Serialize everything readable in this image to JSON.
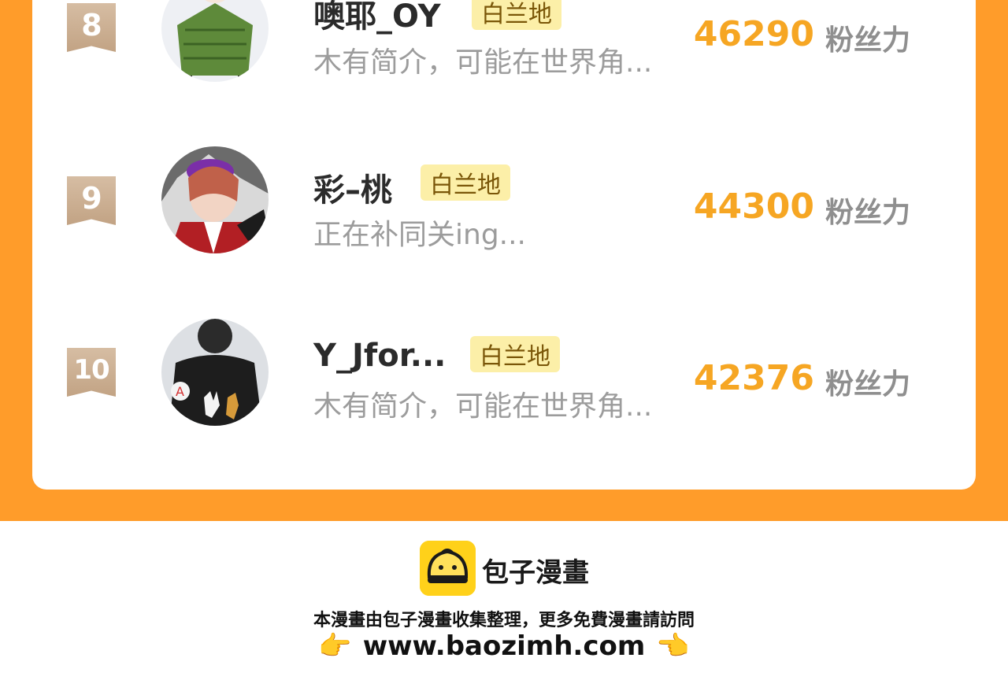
{
  "rows": [
    {
      "rank": "8",
      "name": "噢耶_OY",
      "tag": "白兰地",
      "bio": "木有简介，可能在世界角...",
      "fans": "46290",
      "fans_label": "粉丝力"
    },
    {
      "rank": "9",
      "name": "彩–桃",
      "tag": "白兰地",
      "bio": "正在补同关ing...",
      "fans": "44300",
      "fans_label": "粉丝力"
    },
    {
      "rank": "10",
      "name": "Y_Jfor...",
      "tag": "白兰地",
      "bio": "木有简介，可能在世界角...",
      "fans": "42376",
      "fans_label": "粉丝力"
    }
  ],
  "footer": {
    "brand": "包子漫畫",
    "note": "本漫畫由包子漫畫收集整理，更多免費漫畫請訪問",
    "url": "www.baozimh.com",
    "left_icon": "pointing-right-hand-icon",
    "right_icon": "pointing-left-hand-icon",
    "left_glyph": "👉",
    "right_glyph": "👈"
  },
  "colors": {
    "orange_bg": "#ff9c2a",
    "fans_number": "#f6a623",
    "tag_bg": "#fcefa8",
    "badge": "#c9ab8c",
    "logo_yellow": "#ffd11a"
  }
}
